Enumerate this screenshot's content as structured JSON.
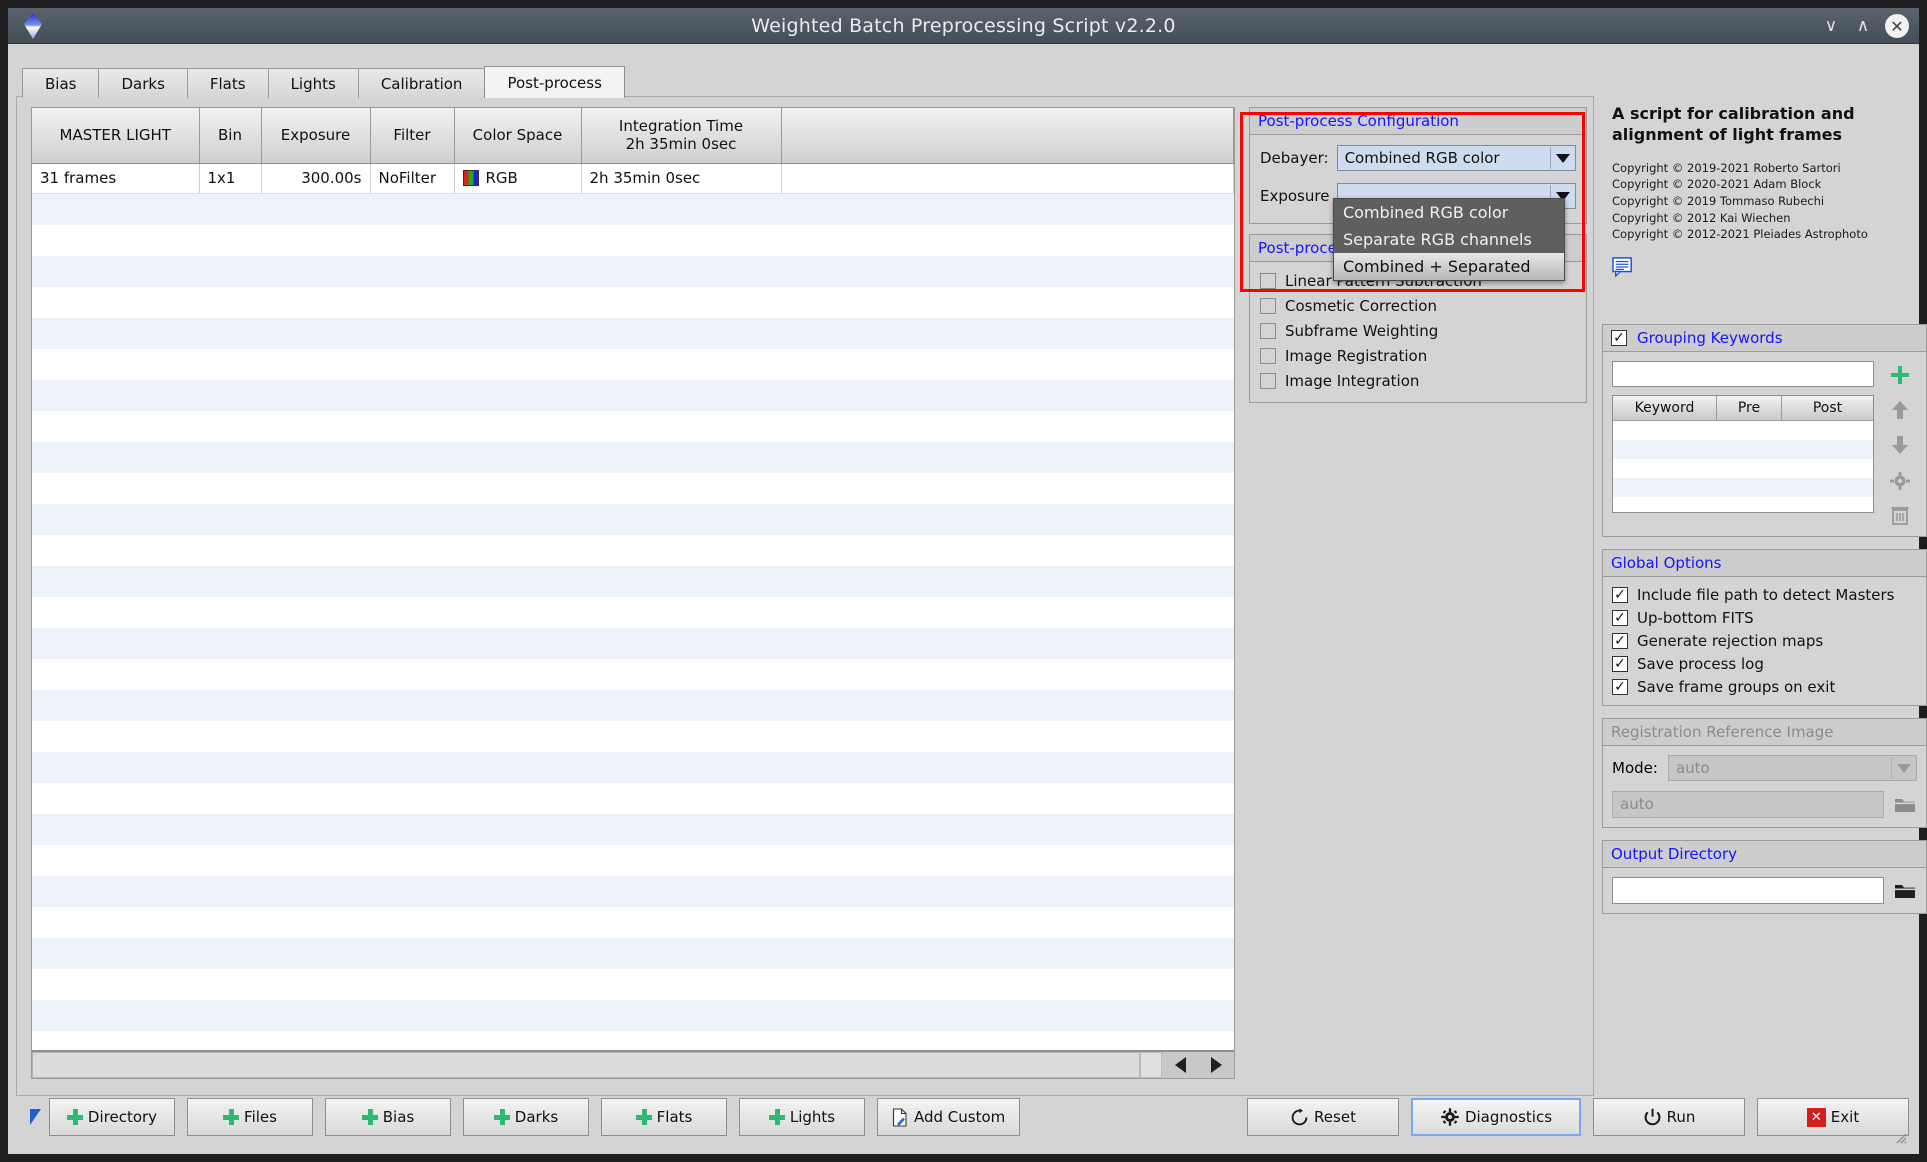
{
  "window": {
    "title": "Weighted Batch Preprocessing Script v2.2.0",
    "minimize": "∨",
    "maximize": "∧",
    "close": "✕",
    "logo_icon": "pixinsight-diamond-icon"
  },
  "tabs": [
    {
      "label": "Bias",
      "active": false
    },
    {
      "label": "Darks",
      "active": false
    },
    {
      "label": "Flats",
      "active": false
    },
    {
      "label": "Lights",
      "active": false
    },
    {
      "label": "Calibration",
      "active": false
    },
    {
      "label": "Post-process",
      "active": true
    }
  ],
  "table": {
    "headers": [
      {
        "line1": "MASTER LIGHT",
        "line2": ""
      },
      {
        "line1": "Bin",
        "line2": ""
      },
      {
        "line1": "Exposure",
        "line2": ""
      },
      {
        "line1": "Filter",
        "line2": ""
      },
      {
        "line1": "Color Space",
        "line2": ""
      },
      {
        "line1": "Integration Time",
        "line2": "2h 35min  0sec"
      },
      {
        "line1": "",
        "line2": ""
      }
    ],
    "rows": [
      {
        "master_light": "31 frames",
        "bin": "1x1",
        "exposure": "300.00s",
        "filter": "NoFilter",
        "color_space": "RGB",
        "integration_time": "2h 35min  0sec",
        "extra": ""
      }
    ]
  },
  "post_process_config": {
    "title": "Post-process  Configuration",
    "debayer_label": "Debayer:",
    "debayer_value": "Combined RGB color",
    "debayer_options": [
      {
        "label": "Combined RGB color",
        "selected": false
      },
      {
        "label": "Separate RGB channels",
        "selected": false
      },
      {
        "label": "Combined + Separated",
        "selected": true
      }
    ],
    "exposure_label": "Exposure",
    "highlight_color": "#ff0000"
  },
  "post_process_group": {
    "title": "Post-process",
    "checkboxes": [
      {
        "label": "Linear Pattern Subtraction",
        "checked": false
      },
      {
        "label": "Cosmetic Correction",
        "checked": false
      },
      {
        "label": "Subframe Weighting",
        "checked": false
      },
      {
        "label": "Image Registration",
        "checked": false
      },
      {
        "label": "Image Integration",
        "checked": false
      }
    ]
  },
  "sidebar": {
    "description": "A script for calibration and alignment of light frames",
    "copyrights": [
      "Copyright © 2019-2021 Roberto Sartori",
      "Copyright © 2020-2021 Adam Block",
      "Copyright © 2019 Tommaso Rubechi",
      "Copyright © 2012 Kai Wiechen",
      "Copyright © 2012-2021 Pleiades Astrophoto"
    ],
    "comment_icon": "comment-balloon-icon",
    "grouping_keywords": {
      "title": "Grouping Keywords",
      "checked": true,
      "input_value": "",
      "columns": [
        "Keyword",
        "Pre",
        "Post"
      ],
      "rows": [],
      "tools": [
        "add-icon",
        "move-up-icon",
        "move-down-icon",
        "settings-gear-icon",
        "delete-trash-icon"
      ]
    },
    "global_options": {
      "title": "Global Options",
      "items": [
        {
          "label": "Include file path to detect Masters",
          "checked": true
        },
        {
          "label": "Up-bottom FITS",
          "checked": true
        },
        {
          "label": "Generate rejection maps",
          "checked": true
        },
        {
          "label": "Save process log",
          "checked": true
        },
        {
          "label": "Save frame groups on exit",
          "checked": true
        }
      ]
    },
    "registration_reference": {
      "title": "Registration Reference Image",
      "mode_label": "Mode:",
      "mode_value": "auto",
      "path_value": "auto",
      "browse_icon": "folder-icon",
      "disabled": true
    },
    "output_directory": {
      "title": "Output Directory",
      "path_value": "",
      "browse_icon": "folder-icon"
    }
  },
  "bottom_buttons": [
    {
      "label": "Directory",
      "icon": "plus-icon"
    },
    {
      "label": "Files",
      "icon": "plus-icon"
    },
    {
      "label": "Bias",
      "icon": "plus-icon"
    },
    {
      "label": "Darks",
      "icon": "plus-icon"
    },
    {
      "label": "Flats",
      "icon": "plus-icon"
    },
    {
      "label": "Lights",
      "icon": "plus-icon"
    },
    {
      "label": "Add Custom",
      "icon": "document-pencil-icon"
    },
    {
      "label": "Reset",
      "icon": "reset-circular-arrow-icon"
    },
    {
      "label": "Diagnostics",
      "icon": "gear-icon"
    },
    {
      "label": "Run",
      "icon": "power-icon"
    },
    {
      "label": "Exit",
      "icon": "red-x-icon"
    }
  ],
  "colors": {
    "accent_blue": "#1414ff",
    "titlebar": "#4d5761",
    "green_plus": "#2eb872",
    "red_highlight": "#ff0000",
    "exit_red": "#d21f1f",
    "row_alt": "#eef2fb"
  }
}
